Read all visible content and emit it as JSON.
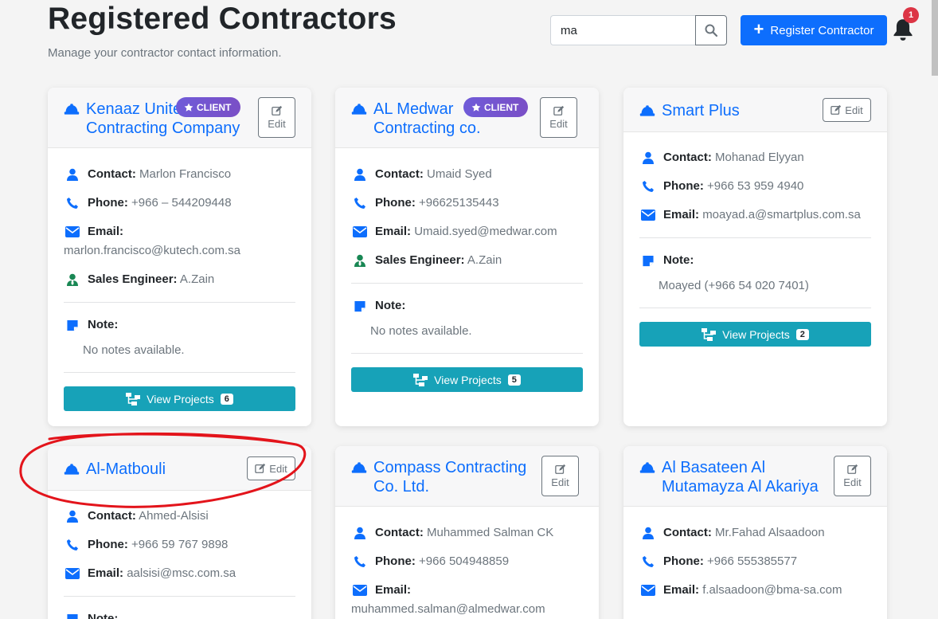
{
  "header": {
    "title": "Registered Contractors",
    "subtitle": "Manage your contractor contact information.",
    "search_value": "ma",
    "register_label": "Register Contractor",
    "notification_count": "1"
  },
  "labels": {
    "contact": "Contact:",
    "phone": "Phone:",
    "email": "Email:",
    "sales_engineer": "Sales Engineer:",
    "note": "Note:",
    "edit": "Edit",
    "view_projects": "View Projects",
    "client": "CLIENT"
  },
  "colors": {
    "primary": "#0d6efd",
    "info": "#17a2b8",
    "client_badge": "#6f5bd8",
    "danger": "#dc3545",
    "sales_icon": "#198754"
  },
  "cards": [
    {
      "name_line1": "Kenaaz Unite",
      "name_line2": "Contracting Company",
      "is_client": true,
      "contact": "Marlon Francisco",
      "phone": "+966 – 544209448",
      "email": "marlon.francisco@kutech.com.sa",
      "sales_engineer": "A.Zain",
      "note": "No notes available.",
      "project_count": "6"
    },
    {
      "name_line1": "AL Medwar",
      "name_line2": "Contracting co.",
      "is_client": true,
      "contact": "Umaid Syed",
      "phone": "+96625135443",
      "email": "Umaid.syed@medwar.com",
      "sales_engineer": "A.Zain",
      "note": "No notes available.",
      "project_count": "5"
    },
    {
      "name_line1": "Smart Plus",
      "is_client": false,
      "contact": "Mohanad Elyyan",
      "phone": "+966 53 959 4940",
      "email": "moayad.a@smartplus.com.sa",
      "note": "Moayed (+966 54 020 7401)",
      "project_count": "2"
    },
    {
      "name_line1": "Al-Matbouli",
      "is_client": false,
      "contact": "Ahmed-Alsisi",
      "phone": "+966 59 767 9898",
      "email": "aalsisi@msc.com.sa",
      "note_label_partial": "Note:"
    },
    {
      "name_line1": "Compass Contracting",
      "name_line2": "Co. Ltd.",
      "is_client": false,
      "contact": "Muhammed Salman CK",
      "phone": "+966 504948859",
      "email": "muhammed.salman@almedwar.com"
    },
    {
      "name_line1": "Al Basateen Al",
      "name_line2": "Mutamayza Al Akariya",
      "is_client": false,
      "contact": "Mr.Fahad Alsaadoon",
      "phone": "+966 555385577",
      "email": "f.alsaadoon@bma-sa.com"
    }
  ]
}
